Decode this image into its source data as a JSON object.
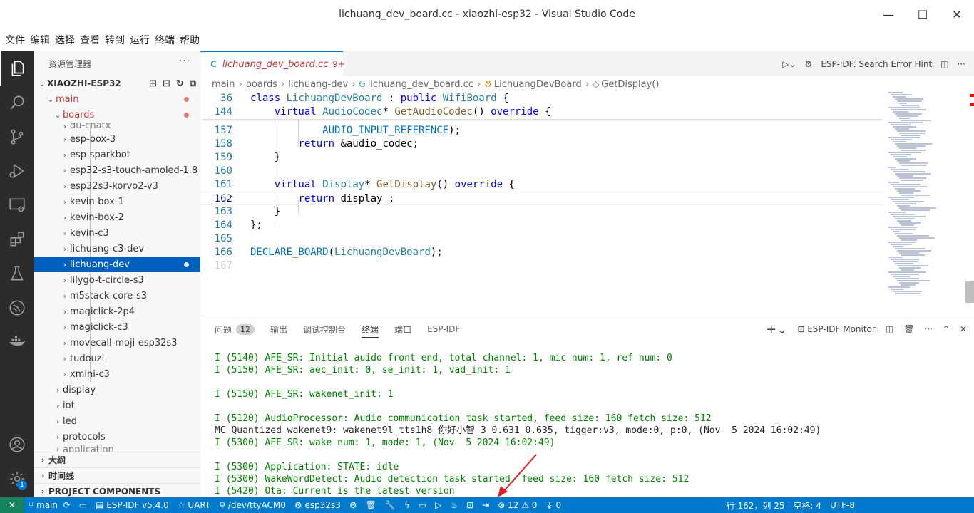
{
  "window": {
    "title": "lichuang_dev_board.cc - xiaozhi-esp32 - Visual Studio Code",
    "minimize": "—",
    "maximize": "☐",
    "close": "✕"
  },
  "menu": [
    "文件",
    "编辑",
    "选择",
    "查看",
    "转到",
    "运行",
    "终端",
    "帮助"
  ],
  "activity_bar": {
    "icons": [
      "explorer-icon",
      "search-icon",
      "source-control-icon",
      "run-debug-icon",
      "remote-explorer-icon",
      "extensions-icon",
      "testing-icon",
      "esp-idf-icon",
      "docker-icon",
      "account-icon",
      "manage-gear-icon"
    ],
    "manage_badge": "1"
  },
  "sidebar": {
    "header": "资源管理器",
    "more": "···",
    "project": "XIAOZHI-ESP32",
    "folders": {
      "main": "main",
      "boards": "boards"
    },
    "partial_top": "du-chatx",
    "board_items": [
      "esp-box-3",
      "esp-sparkbot",
      "esp32-s3-touch-amoled-1.8",
      "esp32s3-korvo2-v3",
      "kevin-box-1",
      "kevin-box-2",
      "kevin-c3",
      "lichuang-c3-dev",
      "lichuang-dev",
      "lilygo-t-circle-s3",
      "m5stack-core-s3",
      "magiclick-2p4",
      "magiclick-c3",
      "movecall-moji-esp32s3",
      "tudouzi",
      "xmini-c3"
    ],
    "selected_item": "lichuang-dev",
    "main_items": [
      "display",
      "iot",
      "led",
      "protocols"
    ],
    "partial_bottom": "application",
    "sections": [
      "大纲",
      "时间线",
      "PROJECT COMPONENTS"
    ]
  },
  "editor": {
    "tab": {
      "name": "lichuang_dev_board.cc",
      "problems": "9+",
      "icon": "C"
    },
    "tab_actions": {
      "esp_hint": "ESP-IDF: Search Error Hint"
    },
    "breadcrumb": [
      "main",
      "boards",
      "lichuang-dev",
      "lichuang_dev_board.cc",
      "LichuangDevBoard",
      "GetDisplay()"
    ],
    "sticky": [
      {
        "ln": "36",
        "code": "class LichuangDevBoard : public WifiBoard {"
      },
      {
        "ln": "144",
        "code": "    virtual AudioCodec* GetAudioCodec() override {"
      }
    ],
    "lines": [
      {
        "ln": "157",
        "code": "            AUDIO_INPUT_REFERENCE);"
      },
      {
        "ln": "158",
        "code": "        return &audio_codec;"
      },
      {
        "ln": "159",
        "code": "    }"
      },
      {
        "ln": "160",
        "code": ""
      },
      {
        "ln": "161",
        "code": "    virtual Display* GetDisplay() override {"
      },
      {
        "ln": "162",
        "code": "        return display_;"
      },
      {
        "ln": "163",
        "code": "    }"
      },
      {
        "ln": "164",
        "code": "};"
      },
      {
        "ln": "165",
        "code": ""
      },
      {
        "ln": "166",
        "code": "DECLARE_BOARD(LichuangDevBoard);"
      },
      {
        "ln": "167",
        "code": ""
      }
    ]
  },
  "panel": {
    "tabs": [
      "问题",
      "输出",
      "调试控制台",
      "终端",
      "端口",
      "ESP-IDF"
    ],
    "problems_count": "12",
    "active_tab": "终端",
    "monitor": "ESP-IDF Monitor",
    "terminal_lines": [
      "I (5140) AFE_SR: Initial auido front-end, total channel: 1, mic num: 1, ref num: 0",
      "I (5150) AFE_SR: aec_init: 0, se_init: 1, vad_init: 1",
      "",
      "I (5150) AFE_SR: wakenet_init: 1",
      "",
      "I (5120) AudioProcessor: Audio communication task started, feed size: 160 fetch size: 512",
      "MC Quantized wakenet9: wakenet9l_tts1h8_你好小智_3_0.631_0.635, tigger:v3, mode:0, p:0, (Nov  5 2024 16:02:49)",
      "I (5300) AFE_SR: wake num: 1, mode: 1, (Nov  5 2024 16:02:49)",
      "",
      "I (5300) Application: STATE: idle",
      "I (5300) WakeWordDetect: Audio detection task started, feed size: 160 fetch size: 512",
      "I (5420) Ota: Current is the latest version"
    ],
    "plain_line_index": 6
  },
  "statusbar": {
    "remote": "✕",
    "branch": "main",
    "idf_version": "ESP-IDF v5.4.0",
    "uart": "UART",
    "port": "/dev/ttyACM0",
    "target": "esp32s3",
    "errors": "12",
    "warnings": "0",
    "ports": "0",
    "position": "行 162，列 25",
    "spaces": "空格: 4",
    "encoding": "UTF-8"
  }
}
